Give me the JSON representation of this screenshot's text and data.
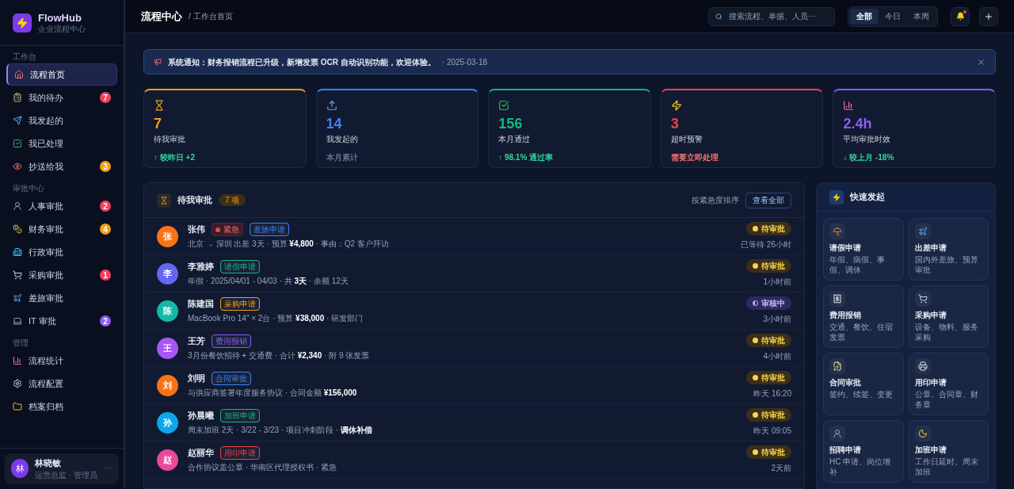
{
  "brand": {
    "name": "FlowHub",
    "subtitle": "企业流程中心"
  },
  "sidebar": {
    "sections": [
      {
        "title": "工作台",
        "items": [
          {
            "label": "流程首页",
            "selected": true
          },
          {
            "label": "我的待办",
            "selected": false,
            "badge": "7",
            "color": "#f43f5e"
          },
          {
            "label": "我发起的",
            "selected": false
          },
          {
            "label": "我已处理",
            "selected": false
          },
          {
            "label": "抄送给我",
            "selected": false,
            "badge": "3",
            "color": "#f59e0b"
          }
        ]
      },
      {
        "title": "审批中心",
        "items": [
          {
            "label": "人事审批",
            "selected": false,
            "badge": "2",
            "color": "#f43f5e"
          },
          {
            "label": "财务审批",
            "selected": false,
            "badge": "4",
            "color": "#f59e0b"
          },
          {
            "label": "行政审批",
            "selected": false
          },
          {
            "label": "采购审批",
            "selected": false,
            "badge": "1",
            "color": "#f43f5e"
          },
          {
            "label": "差旅审批",
            "selected": false
          },
          {
            "label": "IT 审批",
            "selected": false,
            "badge": "2",
            "color": "#8b5cf6"
          }
        ]
      },
      {
        "title": "管理",
        "items": [
          {
            "label": "流程统计",
            "selected": false
          },
          {
            "label": "流程配置",
            "selected": false
          },
          {
            "label": "档案归档",
            "selected": false
          }
        ]
      }
    ],
    "user": {
      "avatar": "林",
      "name": "林晓敏",
      "role": "运营总监 · 管理员",
      "more": "⋯"
    }
  },
  "header": {
    "title": "流程中心",
    "breadcrumb": "/ 工作台首页",
    "search": {
      "placeholder": "搜索流程、单据、人员⋯"
    },
    "filters": [
      {
        "label": "全部",
        "selected": true
      },
      {
        "label": "今日",
        "selected": false
      },
      {
        "label": "本周",
        "selected": false
      }
    ],
    "notification_dot": true
  },
  "notice": {
    "text": "系统通知：财务报销流程已升级，新增发票 OCR 自动识别功能，欢迎体验。",
    "date": "· 2025-03-18"
  },
  "stats": [
    {
      "value": "7",
      "label": "待我审批",
      "sub": {
        "text": "↑ 较昨日 +2",
        "color": "#34d399"
      },
      "color": "#f59e0b"
    },
    {
      "value": "14",
      "label": "我发起的",
      "sub": {
        "text": "本月累计",
        "color": "#64748b"
      },
      "color": "#3b82f6"
    },
    {
      "value": "156",
      "label": "本月通过",
      "sub": {
        "text": "↑ 98.1% 通过率",
        "color": "#34d399"
      },
      "color": "#10b981"
    },
    {
      "value": "3",
      "label": "超时预警",
      "sub": {
        "text": "需要立即处理",
        "color": "#f87171"
      },
      "color": "#ef4444"
    },
    {
      "value": "2.4h",
      "label": "平均审批时效",
      "sub": {
        "text": "↓ 较上月 -18%",
        "color": "#34d399"
      },
      "color": "#8b5cf6"
    }
  ],
  "pending": {
    "title": "待我审批",
    "count": "7 项",
    "sort": "按紧急度排序",
    "view_all": "查看全部",
    "rows": [
      {
        "avatar": "张",
        "color": "#f97316",
        "name": "张伟",
        "tags": [
          {
            "kind": "urgent",
            "text": "紧急"
          },
          {
            "kind": "type",
            "text": "差旅申请",
            "color": "#3b82f6"
          }
        ],
        "detail": "北京 → 深圳 出差 3天 · 预算 **¥4,800** · 事由：Q2 客户拜访",
        "status": {
          "kind": "pending",
          "text": "待审批"
        },
        "time": "已等待 26小时"
      },
      {
        "avatar": "李",
        "color": "#6366f1",
        "name": "李雅婷",
        "tags": [
          {
            "kind": "type",
            "text": "请假申请",
            "color": "#10b981"
          }
        ],
        "detail": "年假 · 2025/04/01 - 04/03 · 共 **3天** · 余额 12天",
        "status": {
          "kind": "pending",
          "text": "待审批"
        },
        "time": "1小时前"
      },
      {
        "avatar": "陈",
        "color": "#14b8a6",
        "name": "陈建国",
        "tags": [
          {
            "kind": "type",
            "text": "采购申请",
            "color": "#f59e0b"
          }
        ],
        "detail": "MacBook Pro 14″ × 2台 · 预算 **¥38,000** · 研发部门",
        "status": {
          "kind": "reviewing",
          "text": "审核中"
        },
        "time": "3小时前"
      },
      {
        "avatar": "王",
        "color": "#a855f7",
        "name": "王芳",
        "tags": [
          {
            "kind": "type",
            "text": "费用报销",
            "color": "#8b5cf6"
          }
        ],
        "detail": "3月份餐饮招待 + 交通费 · 合计 **¥2,340** · 附 9 张发票",
        "status": {
          "kind": "pending",
          "text": "待审批"
        },
        "time": "4小时前"
      },
      {
        "avatar": "刘",
        "color": "#f97316",
        "name": "刘明",
        "tags": [
          {
            "kind": "type",
            "text": "合同审批",
            "color": "#3b82f6"
          }
        ],
        "detail": "与供应商签署年度服务协议 · 合同金额 **¥156,000**",
        "status": {
          "kind": "pending",
          "text": "待审批"
        },
        "time": "昨天 16:20"
      },
      {
        "avatar": "孙",
        "color": "#0ea5e9",
        "name": "孙晨曦",
        "tags": [
          {
            "kind": "type",
            "text": "加班申请",
            "color": "#10b981"
          }
        ],
        "detail": "周末加班 2天 · 3/22 - 3/23 · 项目冲刺阶段 · **调休补偿**",
        "status": {
          "kind": "pending",
          "text": "待审批"
        },
        "time": "昨天 09:05"
      },
      {
        "avatar": "赵",
        "color": "#ec4899",
        "name": "赵丽华",
        "tags": [
          {
            "kind": "type",
            "text": "用印申请",
            "color": "#ef4444"
          }
        ],
        "detail": "合作协议盖公章 · 华南区代理授权书 · 紧急",
        "status": {
          "kind": "pending",
          "text": "待审批"
        },
        "time": "2天前"
      }
    ]
  },
  "quick": {
    "title": "快速发起",
    "items": [
      {
        "title": "请假申请",
        "desc": "年假、病假、事假、调休"
      },
      {
        "title": "出差申请",
        "desc": "国内外差旅、预算审批"
      },
      {
        "title": "费用报销",
        "desc": "交通、餐饮、住宿发票"
      },
      {
        "title": "采购申请",
        "desc": "设备、物料、服务采购"
      },
      {
        "title": "合同审批",
        "desc": "签约、续签、变更"
      },
      {
        "title": "用印申请",
        "desc": "公章、合同章、财务章"
      },
      {
        "title": "招聘申请",
        "desc": "HC 申请、岗位增补"
      },
      {
        "title": "加班申请",
        "desc": "工作日延时、周末加班"
      }
    ]
  }
}
